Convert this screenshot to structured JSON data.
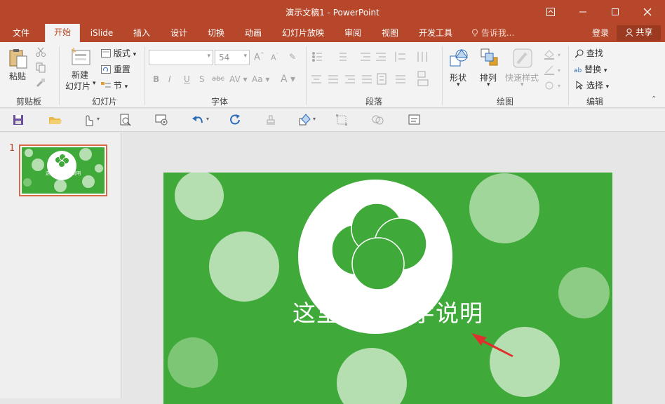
{
  "window": {
    "title": "演示文稿1 - PowerPoint"
  },
  "menu": {
    "tabs": [
      "文件",
      "开始",
      "iSlide",
      "插入",
      "设计",
      "切换",
      "动画",
      "幻灯片放映",
      "审阅",
      "视图",
      "开发工具"
    ],
    "tell_me": "告诉我...",
    "login": "登录",
    "share": "共享"
  },
  "ribbon": {
    "clipboard": {
      "paste": "粘贴",
      "label": "剪贴板"
    },
    "slides": {
      "new_slide_1": "新建",
      "new_slide_2": "幻灯片",
      "layout": "版式",
      "reset": "重置",
      "section": "节",
      "label": "幻灯片"
    },
    "font": {
      "font_size": "54",
      "label": "字体"
    },
    "paragraph": {
      "label": "段落"
    },
    "drawing": {
      "shapes": "形状",
      "arrange": "排列",
      "quick_styles": "快速样式",
      "label": "绘图"
    },
    "editing": {
      "find": "查找",
      "replace": "替换",
      "select": "选择",
      "label": "编辑"
    }
  },
  "thumbnail": {
    "number": "1",
    "text": "这里添加文字说明"
  },
  "slide": {
    "text": "这里添加文字说明"
  },
  "colors": {
    "brand": "#b7472a",
    "slide_green": "#3fa93a",
    "light_circle": "#b5dfb1",
    "arrow": "#e0302e"
  }
}
